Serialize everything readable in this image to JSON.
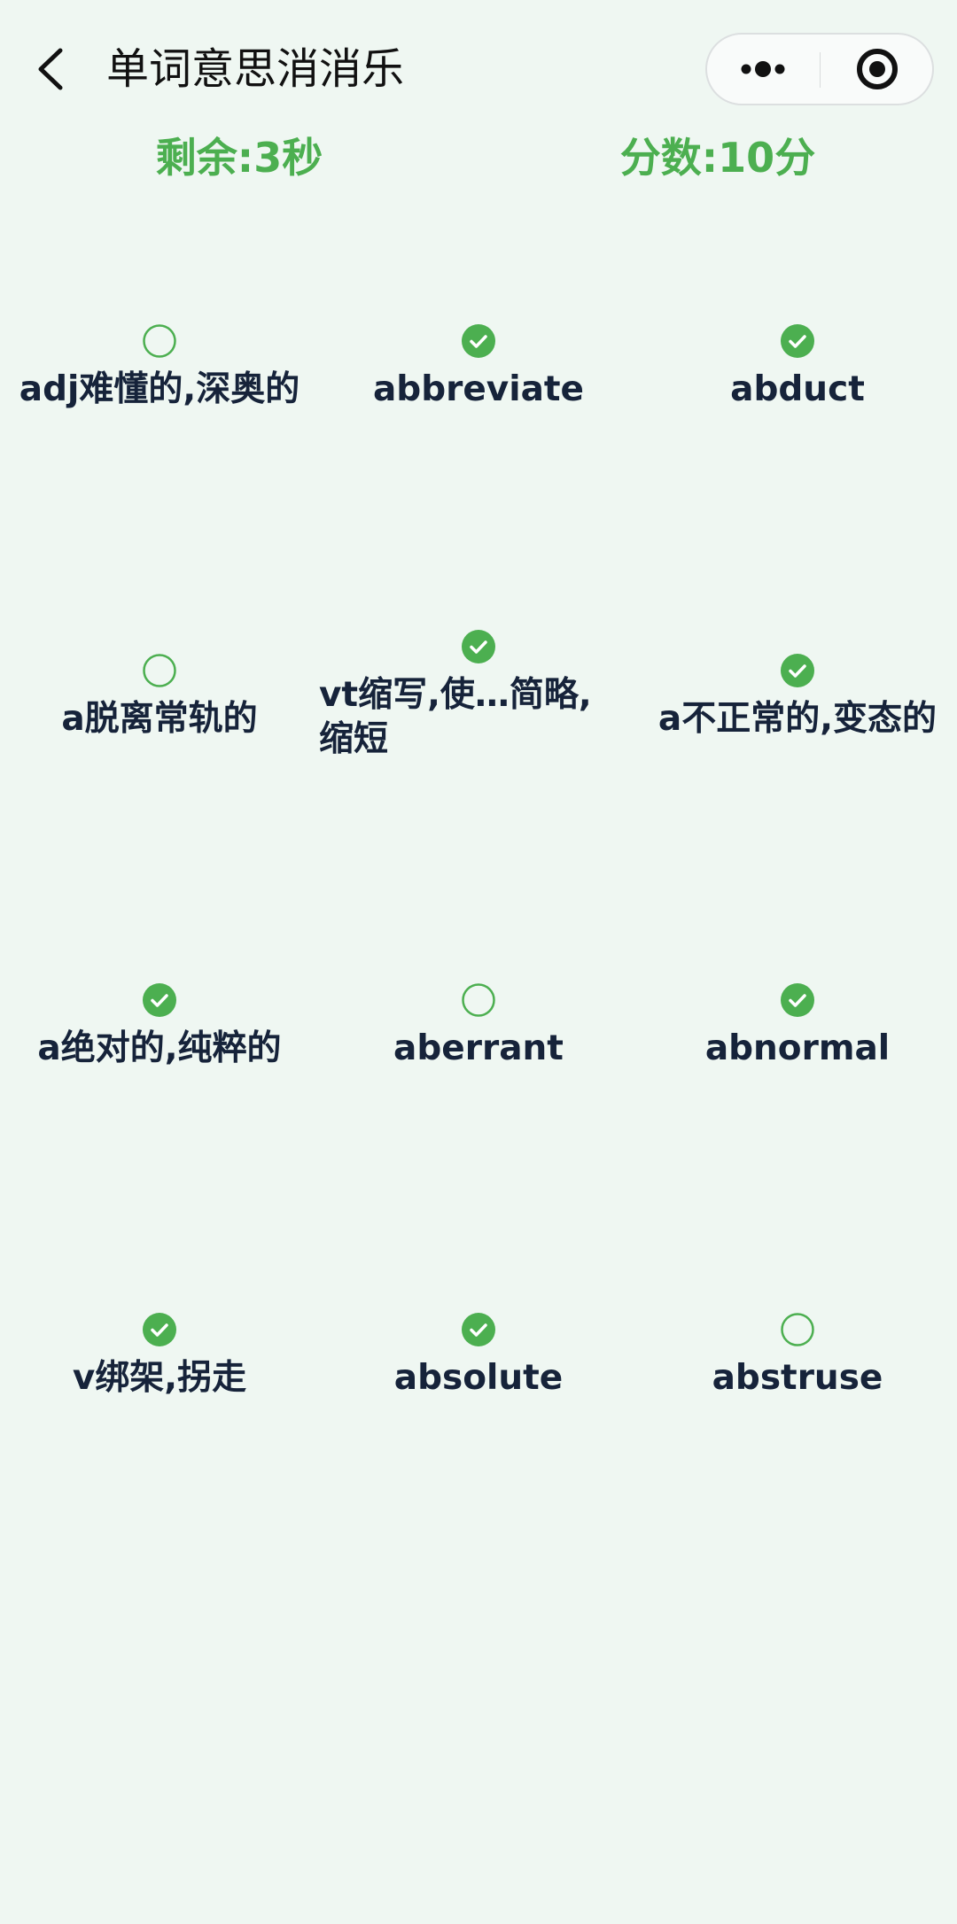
{
  "header": {
    "title": "单词意思消消乐"
  },
  "status": {
    "time_left": "剩余:3秒",
    "score": "分数:10分"
  },
  "colors": {
    "accent": "#4caf50",
    "background": "#eff7f2",
    "text": "#16233a"
  },
  "cells": [
    {
      "label": "adj难懂的,深奥的",
      "checked": false
    },
    {
      "label": "abbreviate",
      "checked": true
    },
    {
      "label": "abduct",
      "checked": true
    },
    {
      "label": "a脱离常轨的",
      "checked": false
    },
    {
      "label": "vt缩写,使…简略,缩短",
      "checked": true
    },
    {
      "label": "a不正常的,变态的",
      "checked": true
    },
    {
      "label": "a绝对的,纯粹的",
      "checked": true
    },
    {
      "label": "aberrant",
      "checked": false
    },
    {
      "label": "abnormal",
      "checked": true
    },
    {
      "label": "v绑架,拐走",
      "checked": true
    },
    {
      "label": "absolute",
      "checked": true
    },
    {
      "label": "abstruse",
      "checked": false
    }
  ]
}
